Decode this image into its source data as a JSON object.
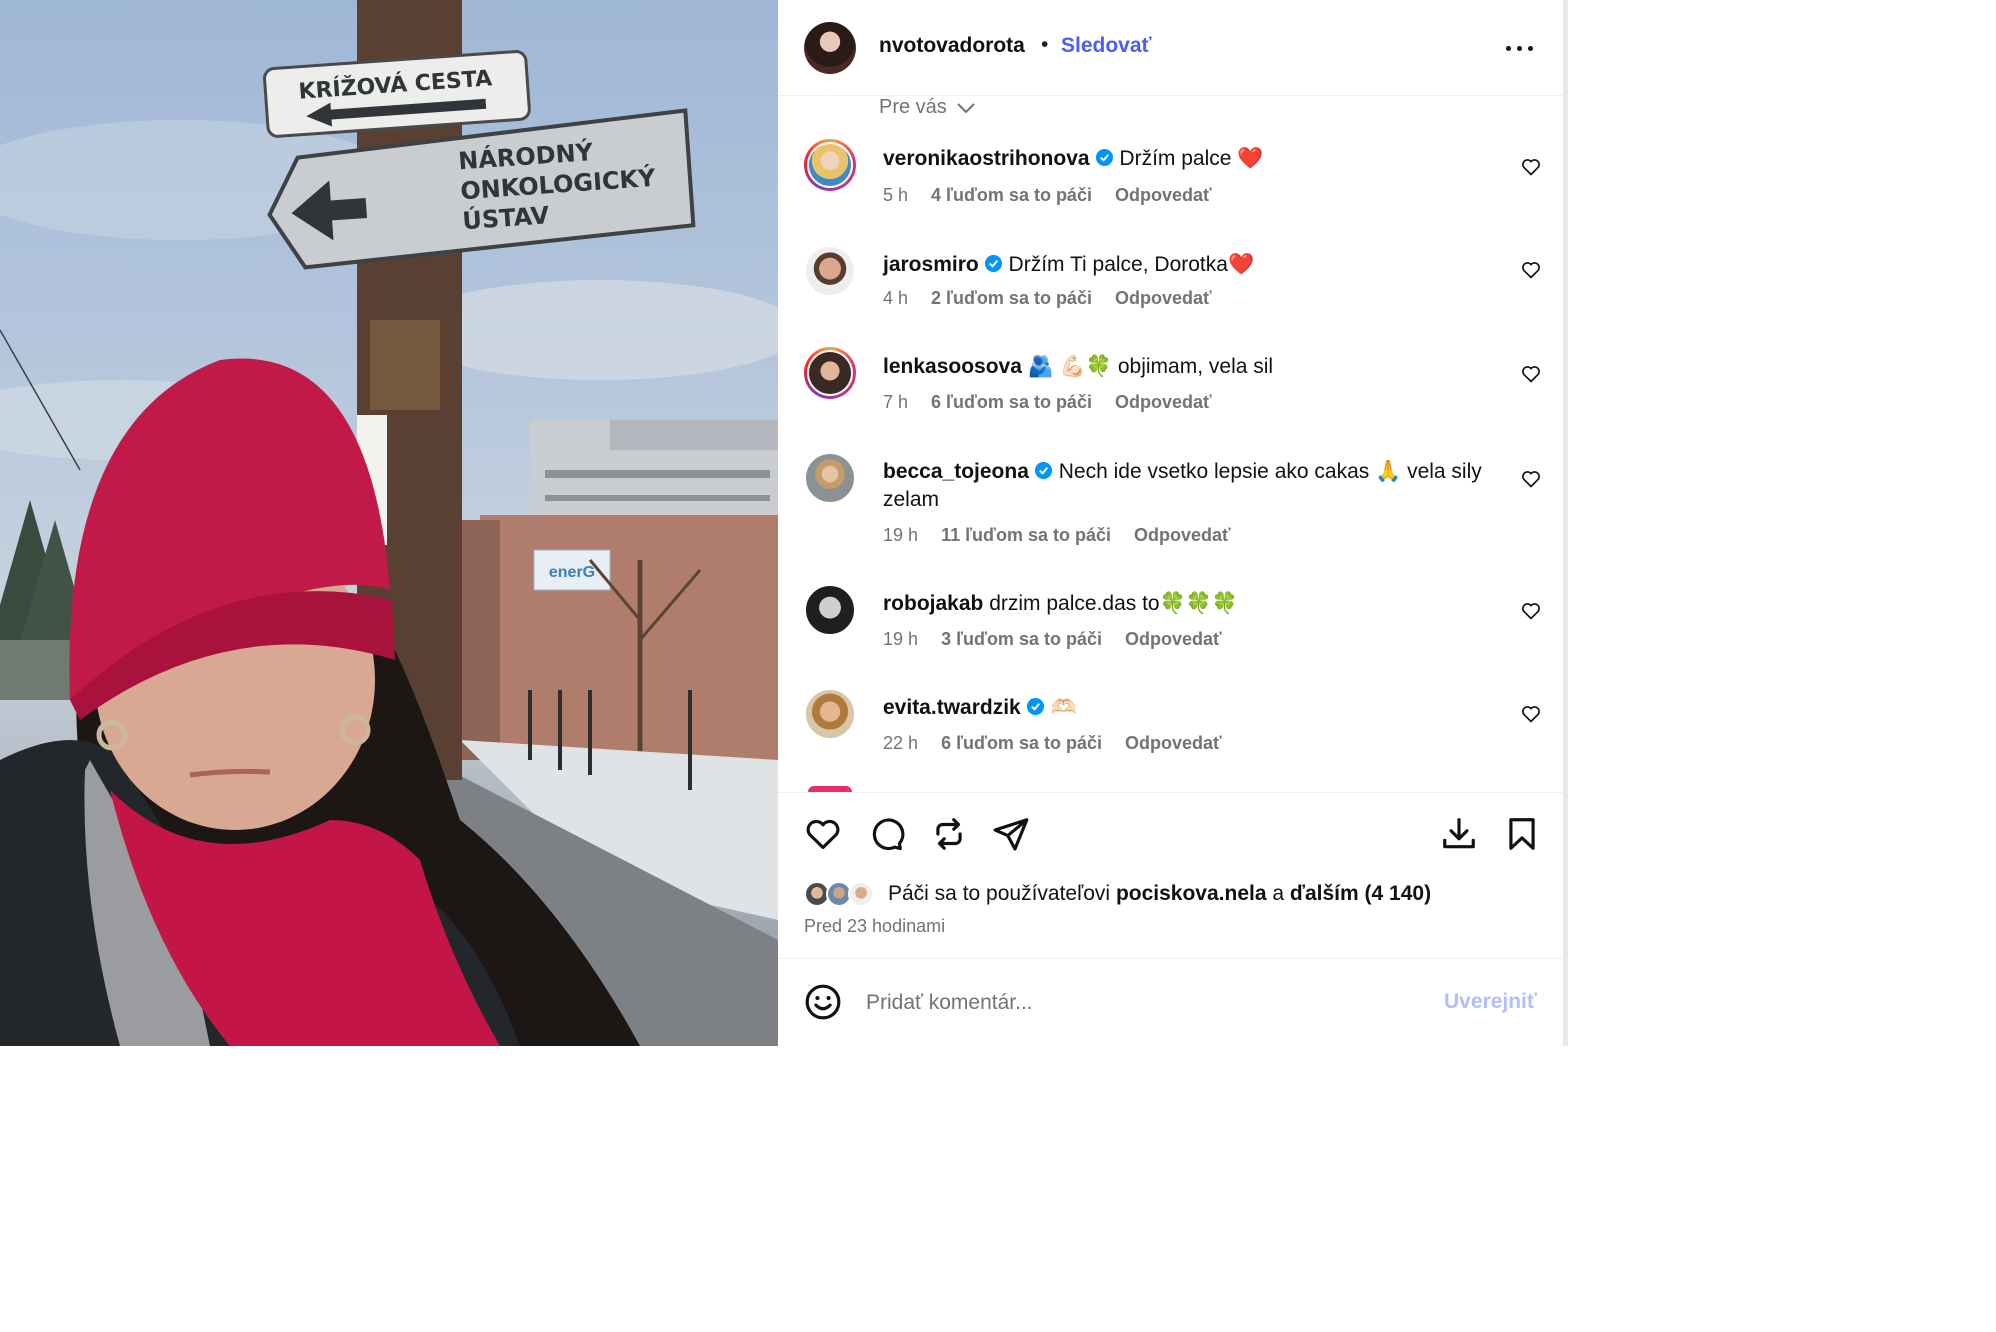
{
  "post": {
    "author": "nvotovadorota",
    "separator": "•",
    "follow_label": "Sledovať",
    "more_icon": "more-horizontal-icon"
  },
  "photo": {
    "sign_top": "KRÍŽOVÁ CESTA",
    "sign_bottom_line1": "NÁRODNÝ",
    "sign_bottom_line2": "ONKOLOGICKÝ",
    "sign_bottom_line3": "ÚSTAV",
    "building_logo": "enerG"
  },
  "filter": {
    "label": "Pre vás"
  },
  "comments": [
    {
      "user": "veronikaostrihonova",
      "verified": true,
      "text": "Držím palce ❤️",
      "time": "5 h",
      "likes": "4 ľuďom sa to páči",
      "reply": "Odpovedať"
    },
    {
      "user": "jarosmiro",
      "verified": true,
      "text": "Držím Ti palce, Dorotka❤️",
      "time": "4 h",
      "likes": "2 ľuďom sa to páči",
      "reply": "Odpovedať"
    },
    {
      "user": "lenkasoosova",
      "verified": false,
      "text": "🫂 💪🏻🍀 objimam, vela sil",
      "time": "7 h",
      "likes": "6 ľuďom sa to páči",
      "reply": "Odpovedať"
    },
    {
      "user": "becca_tojeona",
      "verified": true,
      "text": "Nech ide vsetko lepsie ako cakas 🙏 vela sily zelam",
      "time": "19 h",
      "likes": "11 ľuďom sa to páči",
      "reply": "Odpovedať"
    },
    {
      "user": "robojakab",
      "verified": false,
      "text": "drzim palce.das to🍀🍀🍀",
      "time": "19 h",
      "likes": "3 ľuďom sa to páči",
      "reply": "Odpovedať"
    },
    {
      "user": "evita.twardzik",
      "verified": true,
      "text": "🫶🏻",
      "time": "22 h",
      "likes": "6 ľuďom sa to páči",
      "reply": "Odpovedať"
    }
  ],
  "actions": {
    "like_icon": "heart-icon",
    "comment_icon": "comment-icon",
    "repost_icon": "repost-icon",
    "share_icon": "send-icon",
    "download_icon": "download-icon",
    "save_icon": "bookmark-icon"
  },
  "likes_summary": {
    "prefix": "Páči sa to používateľovi",
    "user": "pociskova.nela",
    "connector": "a",
    "others": "ďalším (4 140)"
  },
  "posted": "Pred 23 hodinami",
  "composer": {
    "placeholder": "Pridať komentár...",
    "post_label": "Uverejniť"
  },
  "colors": {
    "accent": "#4a5df9",
    "post_disabled": "#b2bdfb",
    "secondary_text": "#737373",
    "verified": "#0095f6",
    "heart_red": "#e0245e"
  }
}
